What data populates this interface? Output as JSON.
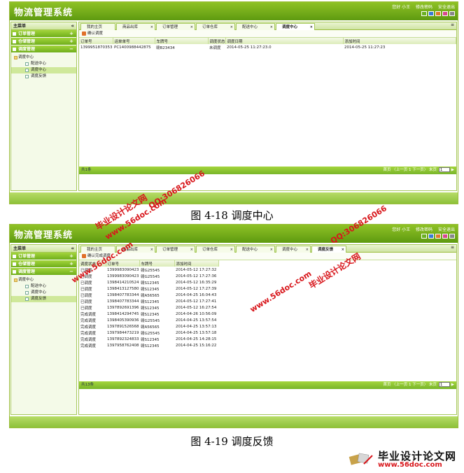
{
  "app_title": "物流管理系统",
  "top_links": [
    "您好 小王",
    "修改密码",
    "安全退出"
  ],
  "sidebar": {
    "header": "主菜单",
    "collapse": "«",
    "groups": [
      {
        "label": "订单管理",
        "sign": "+"
      },
      {
        "label": "仓储管理",
        "sign": "+"
      },
      {
        "label": "调度管理",
        "sign": "−"
      }
    ],
    "tree_root": "调度中心",
    "tree_items": [
      "配送中心",
      "调度中心",
      "调度反馈"
    ]
  },
  "tabs": [
    "我的主页",
    "商品出库",
    "订单管理",
    "订单仓库",
    "配送中心",
    "调度中心"
  ],
  "shot1": {
    "toolbar_label": "确认调度",
    "columns": [
      "订单号",
      "运单单号",
      "车牌号",
      "调度状态",
      "调度日期",
      "添加时间"
    ],
    "rows": [
      [
        "1399951870353",
        "PC1400988442875",
        "赣B23434",
        "未调度",
        "2014-05-25 11:27:23.0",
        "2014-05-25 11:27:23"
      ]
    ],
    "total": "共1条",
    "pager_nav": "首页 〈上一页 1 下一页〉 末页",
    "page_input": "1"
  },
  "caption1": "图 4-18 调度中心",
  "shot2": {
    "extra_tab": "调度反馈",
    "toolbar_label": "确认完成调度",
    "columns": [
      "调度状态",
      "订单号",
      "车牌号",
      "添加时间"
    ],
    "rows": [
      [
        "已调度",
        "1399983090423",
        "赣G25545",
        "2014-05-12 17:27:32"
      ],
      [
        "已调度",
        "1399983090423",
        "赣G25545",
        "2014-05-12 17:27:36"
      ],
      [
        "已调度",
        "1398414210524",
        "赣S12345",
        "2014-05-12 16:35:29"
      ],
      [
        "已调度",
        "1398413127580",
        "赣S12345",
        "2014-05-12 17:27:39"
      ],
      [
        "已调度",
        "1398407783344",
        "赣A56565",
        "2014-04-25 16:04:43"
      ],
      [
        "已调度",
        "1398407783344",
        "赣S12345",
        "2014-05-12 17:27:41"
      ],
      [
        "已调度",
        "1397892691396",
        "赣S12345",
        "2014-05-12 16:27:54"
      ],
      [
        "完成调度",
        "1398414294745",
        "赣S12345",
        "2014-04-26 10:56:09"
      ],
      [
        "完成调度",
        "1398405390936",
        "赣G25545",
        "2014-04-25 13:57:54"
      ],
      [
        "完成调度",
        "1397891526568",
        "赣A56565",
        "2014-04-25 13:57:13"
      ],
      [
        "完成调度",
        "1397984473219",
        "赣G25545",
        "2014-04-25 13:57:18"
      ],
      [
        "完成调度",
        "1397892324833",
        "赣S12345",
        "2014-04-25 14:28:15"
      ],
      [
        "完成调度",
        "1397958762408",
        "赣S12345",
        "2014-04-25 15:16:22"
      ]
    ],
    "total": "共13条",
    "pager_nav": "首页 〈上一页 1 下一页〉 末页",
    "page_input": "1"
  },
  "caption2": "图 4-19 调度反馈",
  "watermarks": {
    "site": "www.56doc.com",
    "qq": "QQ:306826066",
    "brand": "毕业设计论文网"
  },
  "footer": {
    "title": "毕业设计论文网",
    "url": "www.56doc.com"
  }
}
